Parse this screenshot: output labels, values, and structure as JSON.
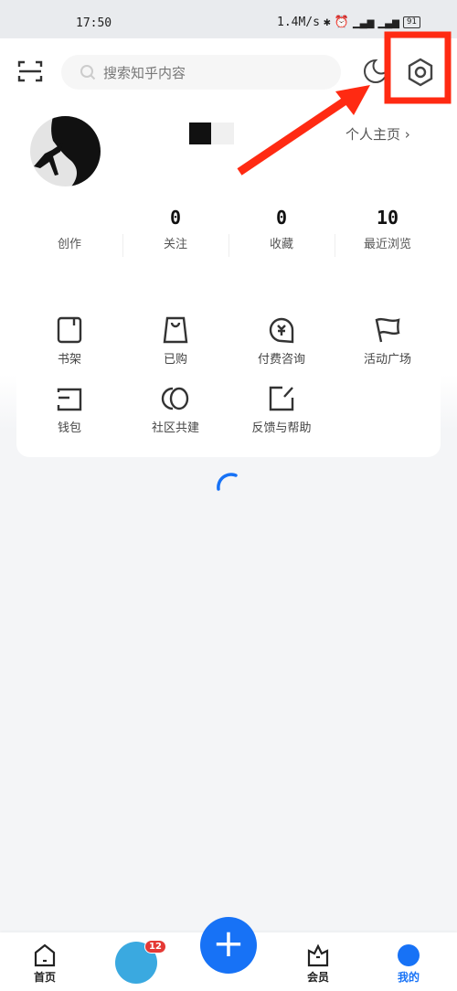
{
  "status_bar": {
    "time": "17:50",
    "speed": "1.4M/s",
    "battery": "91"
  },
  "header": {
    "search_placeholder": "搜索知乎内容"
  },
  "profile": {
    "link_label": "个人主页 ›"
  },
  "stats": [
    {
      "value": "",
      "label": "创作"
    },
    {
      "value": "0",
      "label": "关注"
    },
    {
      "value": "0",
      "label": "收藏"
    },
    {
      "value": "10",
      "label": "最近浏览"
    }
  ],
  "services": [
    {
      "label": "书架",
      "icon": "bookshelf-icon"
    },
    {
      "label": "已购",
      "icon": "shopping-bag-icon"
    },
    {
      "label": "付费咨询",
      "icon": "paid-consult-icon"
    },
    {
      "label": "活动广场",
      "icon": "flag-icon"
    },
    {
      "label": "钱包",
      "icon": "wallet-icon"
    },
    {
      "label": "社区共建",
      "icon": "community-icon"
    },
    {
      "label": "反馈与帮助",
      "icon": "feedback-icon"
    }
  ],
  "nav": {
    "home": "首页",
    "badge": "12",
    "plus": "+",
    "vip": "会员",
    "me": "我的"
  },
  "colors": {
    "accent": "#1772f6",
    "annotation": "#ff2a12",
    "badge": "#e53935"
  }
}
